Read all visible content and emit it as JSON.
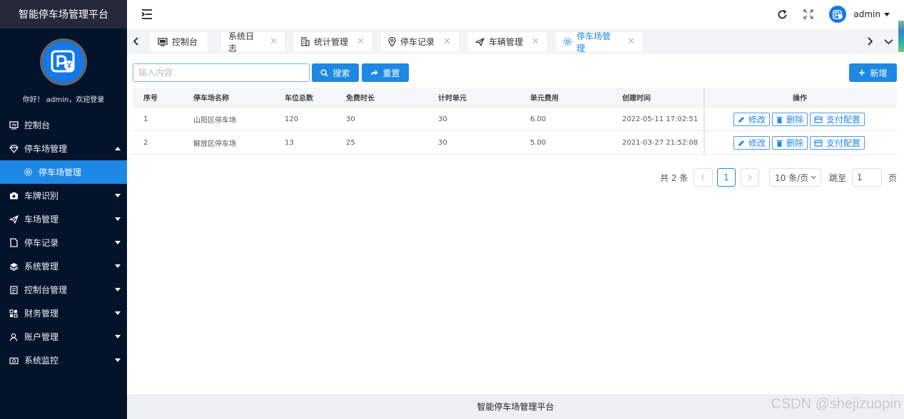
{
  "app": {
    "title": "智能停车场管理平台",
    "welcome": "你好！ admin，欢迎登录"
  },
  "sidebar": {
    "items": [
      {
        "label": "控制台",
        "icon": "monitor-icon"
      },
      {
        "label": "停车场管理",
        "icon": "diamond-icon",
        "expanded": true
      },
      {
        "label": "停车场管理",
        "icon": "gear-icon",
        "sub": true,
        "active": true
      },
      {
        "label": "车牌识别",
        "icon": "camera-icon"
      },
      {
        "label": "车场管理",
        "icon": "send-icon"
      },
      {
        "label": "停车记录",
        "icon": "document-icon"
      },
      {
        "label": "系统管理",
        "icon": "layers-icon"
      },
      {
        "label": "控制台管理",
        "icon": "clipboard-icon"
      },
      {
        "label": "财务管理",
        "icon": "grid-icon"
      },
      {
        "label": "账户管理",
        "icon": "user-icon"
      },
      {
        "label": "系统监控",
        "icon": "camera-icon"
      }
    ]
  },
  "header": {
    "username": "admin"
  },
  "tabs": [
    {
      "label": "控制台",
      "icon": "monitor-icon",
      "closable": false
    },
    {
      "label": "系统日志",
      "icon": "",
      "closable": true
    },
    {
      "label": "统计管理",
      "icon": "building-icon",
      "closable": true
    },
    {
      "label": "停车记录",
      "icon": "location-icon",
      "closable": true
    },
    {
      "label": "车辆管理",
      "icon": "send-icon",
      "closable": true
    },
    {
      "label": "停车场管理",
      "icon": "gear-icon",
      "closable": true,
      "active": true
    }
  ],
  "toolbar": {
    "search_placeholder": "输入内容",
    "search_label": "搜索",
    "reset_label": "重置",
    "add_label": "新增"
  },
  "table": {
    "columns": [
      "序号",
      "停车场名称",
      "车位总数",
      "免费时长",
      "计时单元",
      "单元费用",
      "创建时间",
      "操作"
    ],
    "rows": [
      [
        "1",
        "山阳区停车场",
        "120",
        "30",
        "30",
        "6.00",
        "2022-05-11 17:02:51"
      ],
      [
        "2",
        "解放区停车场",
        "13",
        "25",
        "30",
        "5.00",
        "2021-03-27 21:52:08"
      ]
    ],
    "actions": {
      "edit": "修改",
      "delete": "删除",
      "pay": "支付配置"
    }
  },
  "pagination": {
    "total": "共 2 条",
    "current_page": "1",
    "page_size": "10 条/页",
    "jump_label": "跳至",
    "jump_value": "1",
    "page_suffix": "页"
  },
  "footer": {
    "text": "智能停车场管理平台"
  },
  "watermark": "CSDN @shejizuopin",
  "colors": {
    "sidebar_bg": "#03132a",
    "accent": "#1e88e5",
    "brand_bg": "#25293a"
  }
}
